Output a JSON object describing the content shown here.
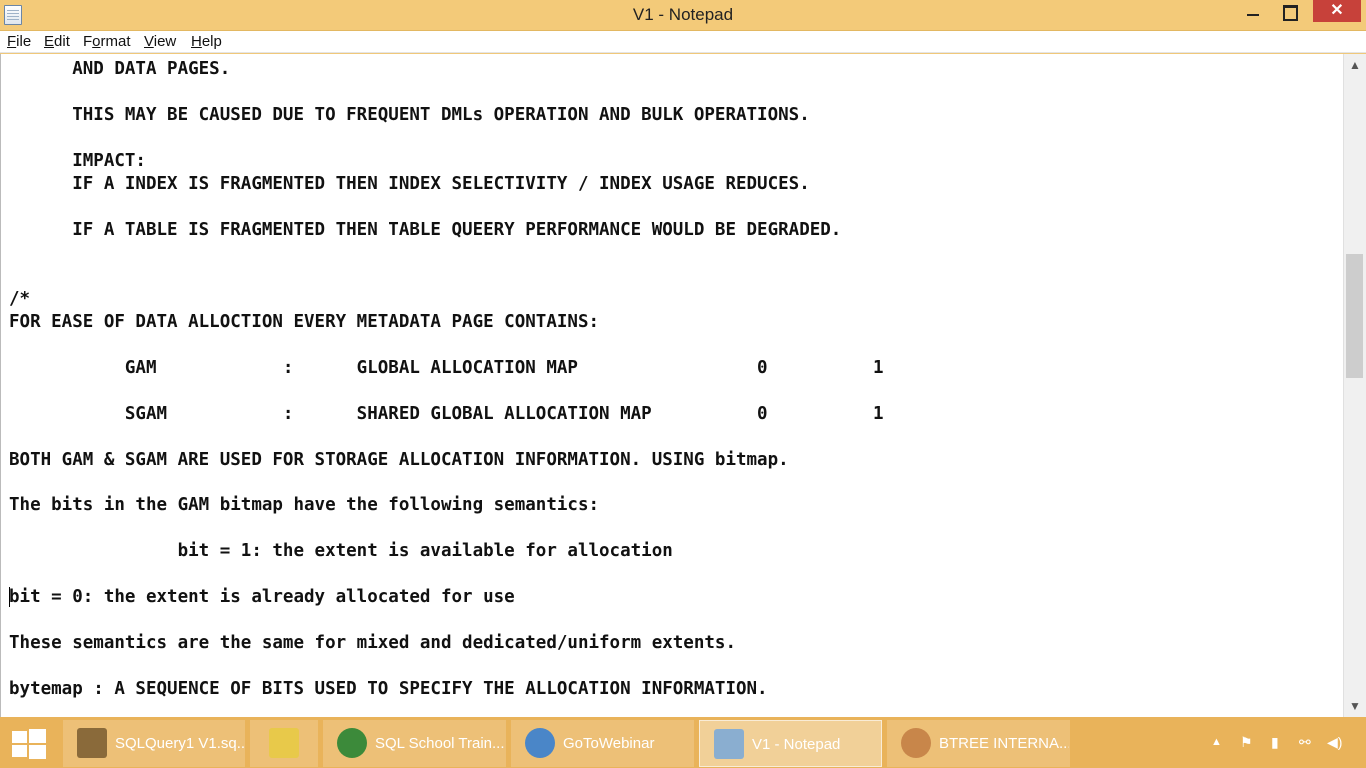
{
  "window": {
    "title": "V1 - Notepad",
    "close_glyph": "✕"
  },
  "menu": [
    {
      "pre": "",
      "ul": "F",
      "post": "ile"
    },
    {
      "pre": "",
      "ul": "E",
      "post": "dit"
    },
    {
      "pre": "F",
      "ul": "o",
      "post": "rmat"
    },
    {
      "pre": "",
      "ul": "V",
      "post": "iew"
    },
    {
      "pre": "",
      "ul": "H",
      "post": "elp"
    }
  ],
  "editor_lines": [
    "      AND DATA PAGES.",
    "      THIS MAY BE CAUSED DUE TO FREQUENT DMLs OPERATION AND BULK OPERATIONS.",
    "      IMPACT:",
    "      IF A INDEX IS FRAGMENTED THEN INDEX SELECTIVITY / INDEX USAGE REDUCES.",
    "      IF A TABLE IS FRAGMENTED THEN TABLE QUEERY PERFORMANCE WOULD BE DEGRADED.",
    "/*",
    "FOR EASE OF DATA ALLOCTION EVERY METADATA PAGE CONTAINS:",
    "           GAM            :      GLOBAL ALLOCATION MAP                 0          1",
    "           SGAM           :      SHARED GLOBAL ALLOCATION MAP          0          1",
    "BOTH GAM & SGAM ARE USED FOR STORAGE ALLOCATION INFORMATION. USING bitmap.",
    "The bits in the GAM bitmap have the following semantics:",
    "                bit = 1: the extent is available for allocation",
    "bit = 0: the extent is already allocated for use",
    "These semantics are the same for mixed and dedicated/uniform extents.",
    "bytemap : A SEQUENCE OF BITS USED TO SPECIFY THE ALLOCATION INFORMATION."
  ],
  "taskbar": {
    "items": [
      {
        "label": "SQLQuery1 V1.sq...",
        "icon": "sql-tool-icon",
        "color": "#8a6a3a",
        "active": false
      },
      {
        "label": "",
        "icon": "file-explorer-icon",
        "color": "#e8c94a",
        "active": false
      },
      {
        "label": "SQL School Train...",
        "icon": "chrome-icon",
        "color": "#3c8a3a",
        "active": false
      },
      {
        "label": "GoToWebinar",
        "icon": "gotowebinar-icon",
        "color": "#4a86c8",
        "active": false
      },
      {
        "label": "V1 - Notepad",
        "icon": "notepad-icon",
        "color": "#8aaed0",
        "active": true
      },
      {
        "label": "BTREE INTERNA...",
        "icon": "paint-icon",
        "color": "#c8864a",
        "active": false
      }
    ],
    "tray": [
      "▲",
      "⚑",
      "▮",
      "⚯",
      "◀)"
    ]
  }
}
